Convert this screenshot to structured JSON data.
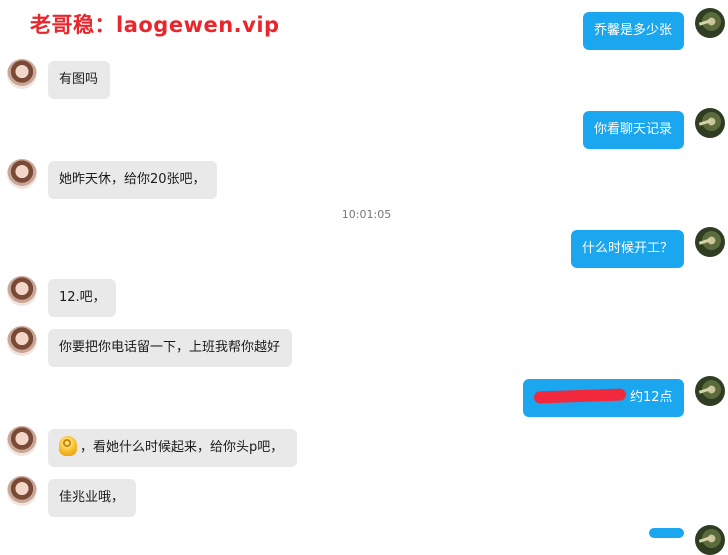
{
  "watermark": "老哥稳：laogewen.vip",
  "timestamp": "10:01:05",
  "messages": {
    "m1": "乔馨是多少张",
    "m2": "有图吗",
    "m3": "你看聊天记录",
    "m4": "她昨天休，给你20张吧，",
    "m5": "什么时候开工？",
    "m6": "12.吧，",
    "m7": "你要把你电话留一下，上班我帮你越好",
    "m8": "约12点",
    "m9": "，看她什么时候起来，给你头p吧，",
    "m10": "佳兆业哦，"
  },
  "colors": {
    "outgoing_bubble": "#1aa7f0",
    "incoming_bubble": "#e9e9e9",
    "redaction": "#f2293d",
    "watermark": "#e8262b"
  },
  "icons": {
    "emoji": "ok-hand"
  }
}
